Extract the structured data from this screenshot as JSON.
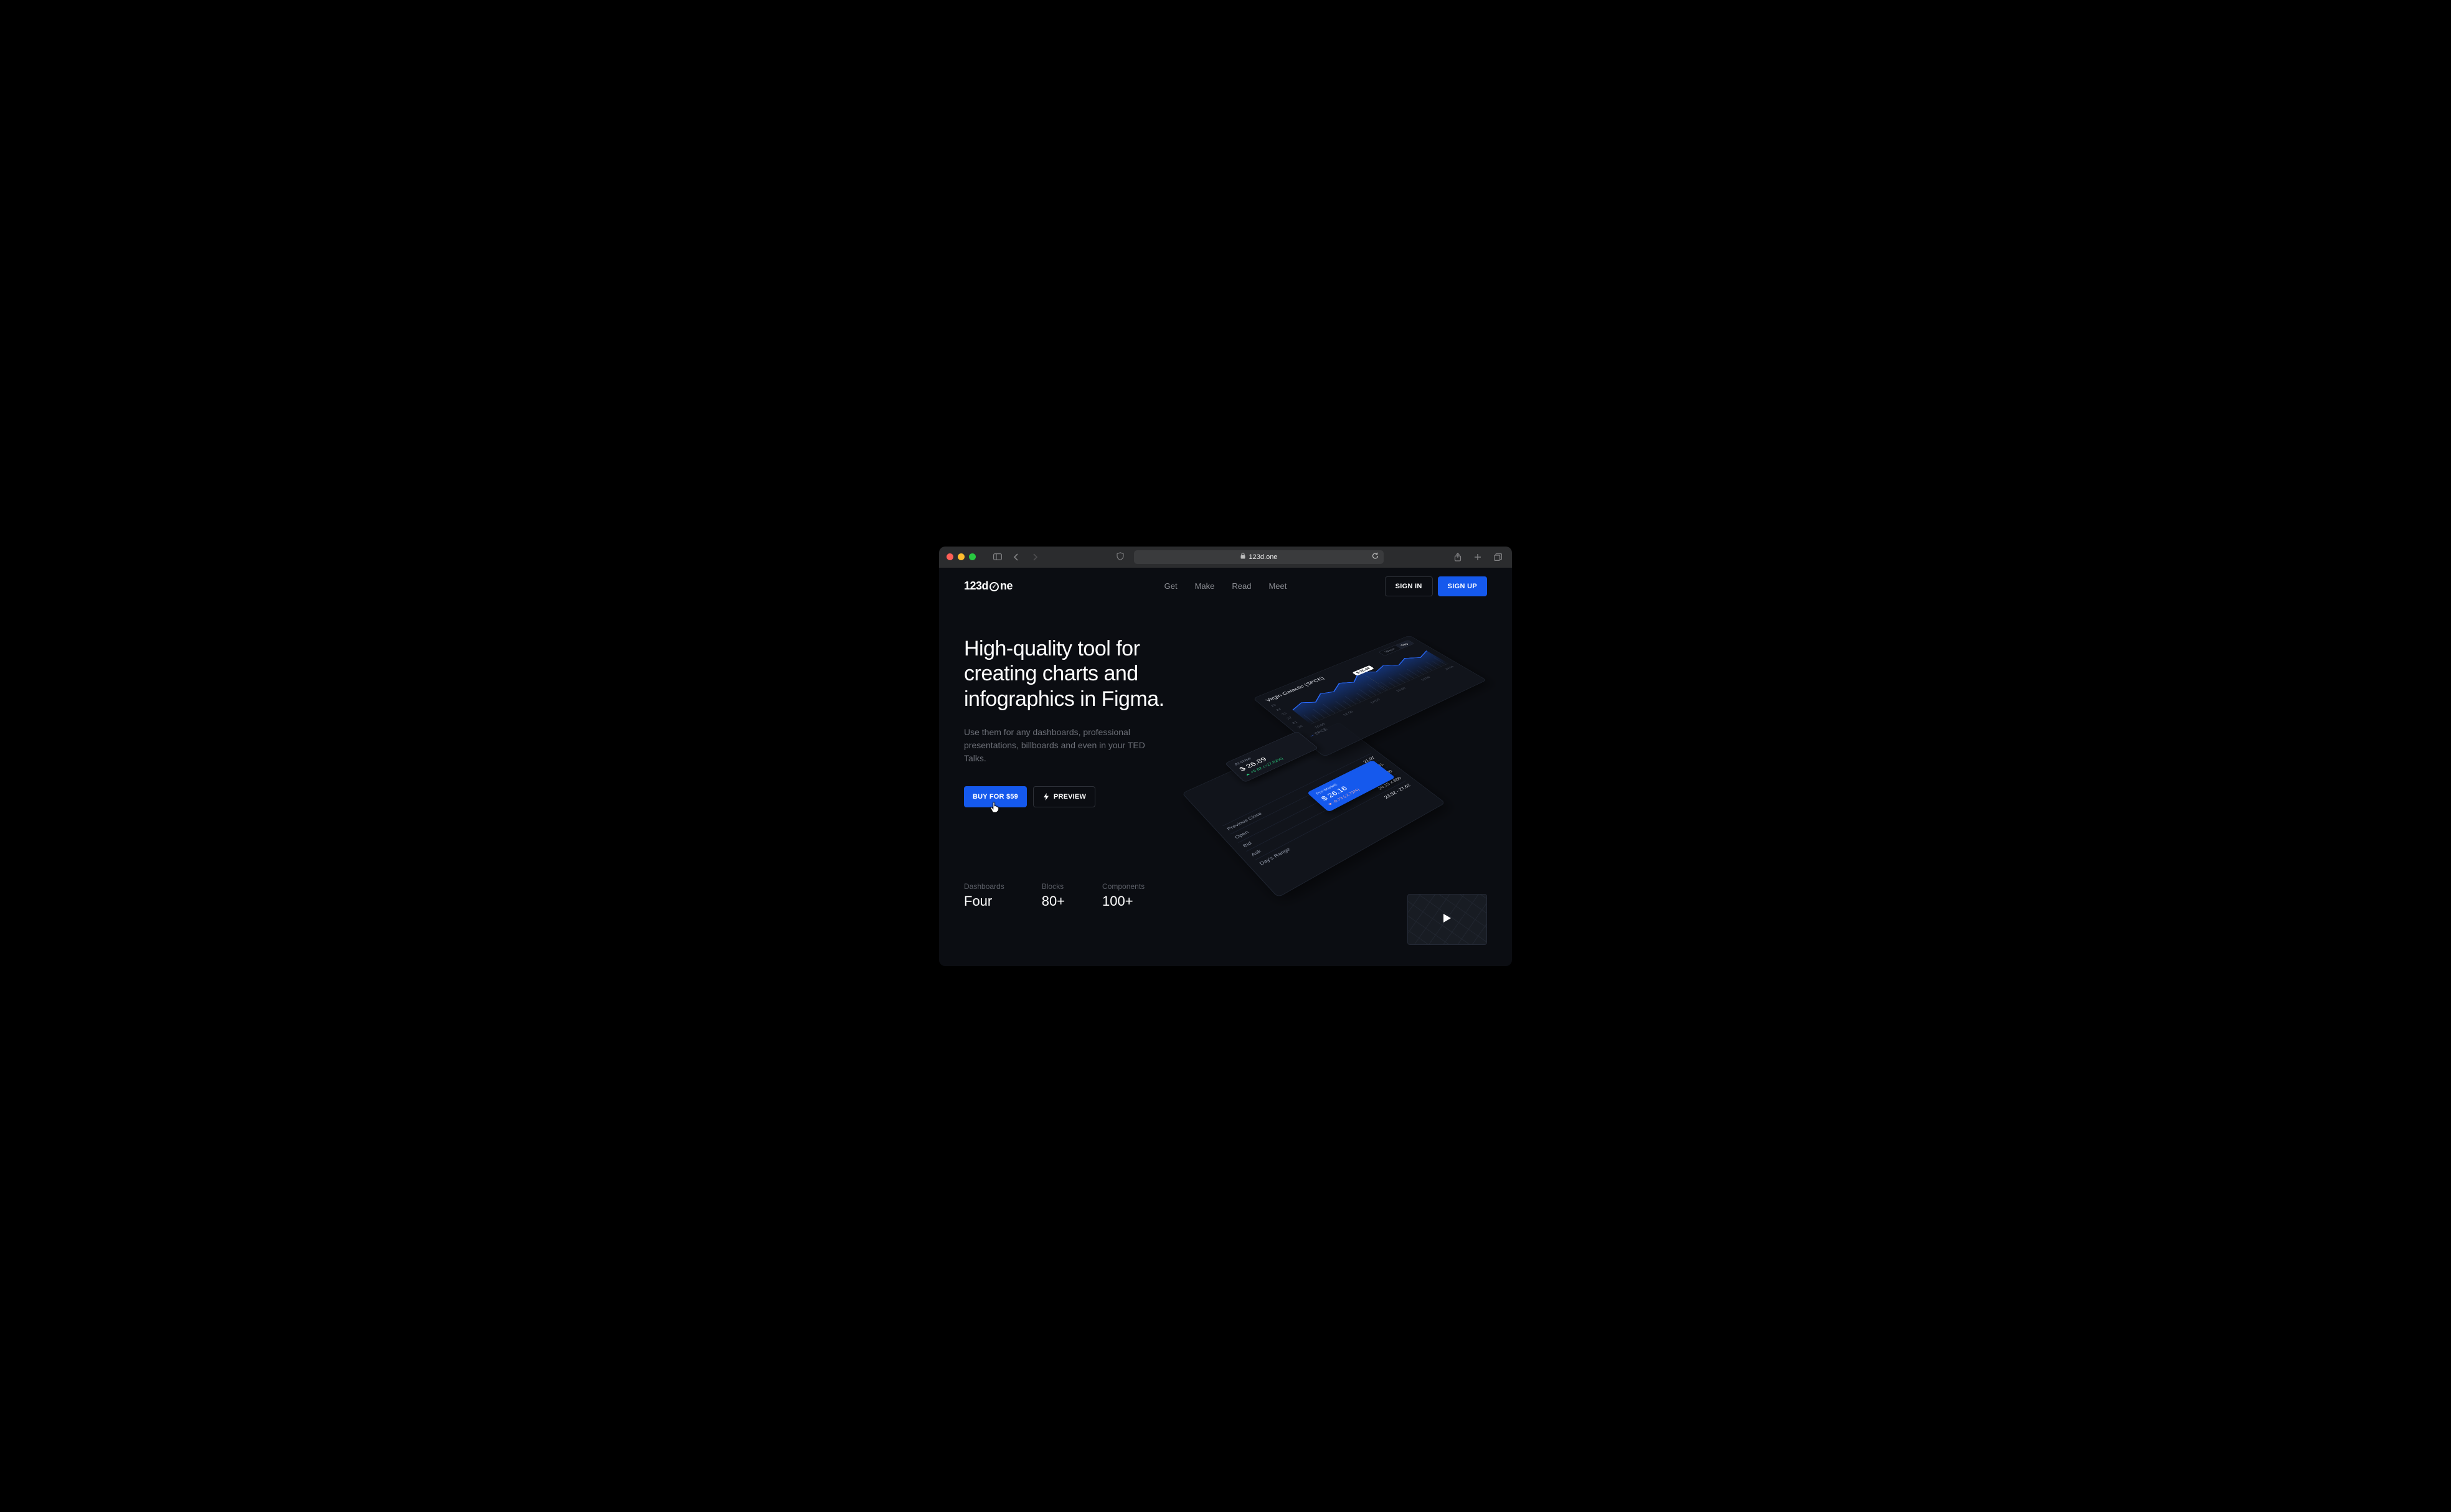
{
  "browser": {
    "url": "123d.one"
  },
  "nav": {
    "logo_pre": "123d",
    "logo_post": "ne",
    "links": [
      "Get",
      "Make",
      "Read",
      "Meet"
    ],
    "signin": "SIGN IN",
    "signup": "SIGN UP"
  },
  "hero": {
    "title": "High-quality tool for creating charts and infographics in Figma.",
    "subtitle": "Use them for any dashboards, professional presentations, billboards and even in your TED Talks.",
    "buy": "BUY FOR $59",
    "preview": "PREVIEW"
  },
  "stats": [
    {
      "label": "Dashboards",
      "value": "Four"
    },
    {
      "label": "Blocks",
      "value": "80+"
    },
    {
      "label": "Components",
      "value": "100+"
    }
  ],
  "mock": {
    "stock": "Virgin Galactic (SPCE)",
    "toggle": {
      "inactive": "Week",
      "active": "Day"
    },
    "bubble": "$ 25.49",
    "yaxis": [
      "25",
      "24",
      "23",
      "22",
      "21",
      "20"
    ],
    "xaxis": [
      "10:00",
      "12:00",
      "14:00",
      "16:00",
      "18:00",
      "20:00"
    ],
    "legend": "SPCE",
    "card1": {
      "title": "At close",
      "price": "$ 26.89",
      "delta": "+5.82 (+27.62%)"
    },
    "card2": {
      "title": "Pre-Market",
      "price": "$ 26.16",
      "delta": "-0.73 (-2.71%)"
    },
    "rows": [
      {
        "k": "Previous Close",
        "v": "21.07"
      },
      {
        "k": "Open",
        "v": "25.31"
      },
      {
        "k": "Bid",
        "v": "0.00 x 900"
      },
      {
        "k": "Ask",
        "v": "26.15 x 800"
      },
      {
        "k": "Day's Range",
        "v": "23.52 - 27.62"
      }
    ]
  }
}
